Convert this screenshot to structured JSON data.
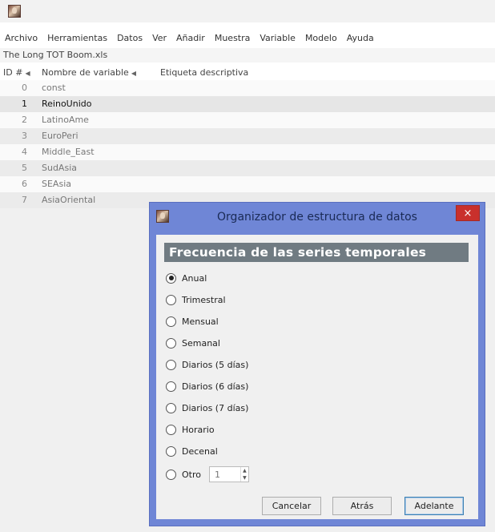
{
  "menu": [
    {
      "label": "Archivo"
    },
    {
      "label": "Herramientas"
    },
    {
      "label": "Datos"
    },
    {
      "label": "Ver"
    },
    {
      "label": "Añadir"
    },
    {
      "label": "Muestra"
    },
    {
      "label": "Variable"
    },
    {
      "label": "Modelo"
    },
    {
      "label": "Ayuda"
    }
  ],
  "filename": "The Long TOT Boom.xls",
  "list_header": {
    "id": "ID #",
    "name": "Nombre de variable",
    "label": "Etiqueta descriptiva"
  },
  "variables": [
    {
      "id": "0",
      "name": "const"
    },
    {
      "id": "1",
      "name": "ReinoUnido"
    },
    {
      "id": "2",
      "name": "LatinoAme"
    },
    {
      "id": "3",
      "name": "EuroPeri"
    },
    {
      "id": "4",
      "name": "Middle_East"
    },
    {
      "id": "5",
      "name": "SudAsia"
    },
    {
      "id": "6",
      "name": "SEAsia"
    },
    {
      "id": "7",
      "name": "AsiaOriental"
    }
  ],
  "selected_variable_index": 1,
  "dialog": {
    "title": "Organizador de estructura de datos",
    "close_glyph": "×",
    "heading": "Frecuencia de las series temporales",
    "options": [
      {
        "label": "Anual",
        "checked": true
      },
      {
        "label": "Trimestral",
        "checked": false
      },
      {
        "label": "Mensual",
        "checked": false
      },
      {
        "label": "Semanal",
        "checked": false
      },
      {
        "label": "Diarios (5 días)",
        "checked": false
      },
      {
        "label": "Diarios (6 días)",
        "checked": false
      },
      {
        "label": "Diarios (7 días)",
        "checked": false
      },
      {
        "label": "Horario",
        "checked": false
      },
      {
        "label": "Decenal",
        "checked": false
      },
      {
        "label": "Otro",
        "checked": false
      }
    ],
    "other_value": "1",
    "buttons": {
      "cancel": "Cancelar",
      "back": "Atrás",
      "forward": "Adelante"
    }
  },
  "colors": {
    "dialog_frame": "#6f86d6",
    "heading_bg": "#707b82",
    "close_bg": "#c9302c"
  }
}
